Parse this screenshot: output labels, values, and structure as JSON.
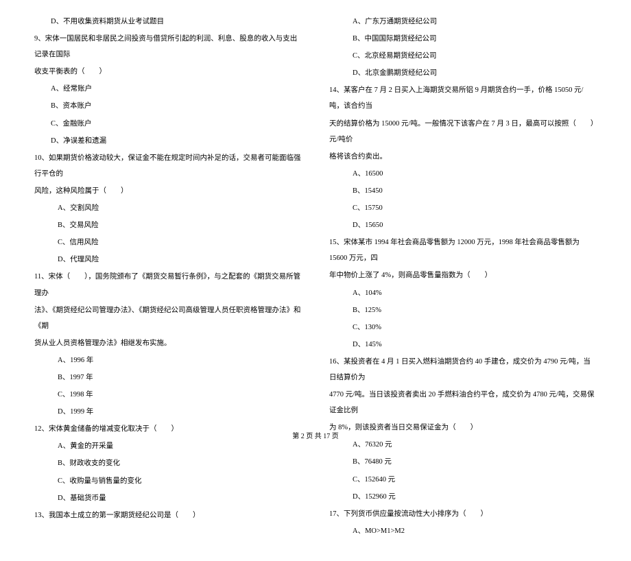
{
  "left": {
    "lines": [
      {
        "cls": "indent1",
        "text": "D、不用收集资料期货从业考试题目"
      },
      {
        "cls": "",
        "text": "9、宋体一国居民和非居民之间投资与借贷所引起的利润、利息、股息的收入与支出记录在国际"
      },
      {
        "cls": "",
        "text": "收支平衡表的（　　）"
      },
      {
        "cls": "indent1",
        "text": "A、经常账户"
      },
      {
        "cls": "indent1",
        "text": "B、资本账户"
      },
      {
        "cls": "indent1",
        "text": "C、金融账户"
      },
      {
        "cls": "indent1",
        "text": "D、净误差和遗漏"
      },
      {
        "cls": "",
        "text": "10、如果期货价格波动较大，保证金不能在规定时间内补足的话，交易者可能面临强行平仓的"
      },
      {
        "cls": "",
        "text": "风险，这种风险属于（　　）"
      },
      {
        "cls": "indent2",
        "text": "A、交割风险"
      },
      {
        "cls": "indent2",
        "text": "B、交易风险"
      },
      {
        "cls": "indent2",
        "text": "C、信用风险"
      },
      {
        "cls": "indent2",
        "text": "D、代理风险"
      },
      {
        "cls": "",
        "text": "11、宋体（　　），国务院颁布了《期货交易暂行条例》，与之配套的《期货交易所管理办"
      },
      {
        "cls": "",
        "text": "法》、《期货经纪公司管理办法》、《期货经纪公司高级管理人员任职资格管理办法》和《期"
      },
      {
        "cls": "",
        "text": "货从业人员资格管理办法》相继发布实施。"
      },
      {
        "cls": "indent2",
        "text": "A、1996 年"
      },
      {
        "cls": "indent2",
        "text": "B、1997 年"
      },
      {
        "cls": "indent2",
        "text": "C、1998 年"
      },
      {
        "cls": "indent2",
        "text": "D、1999 年"
      },
      {
        "cls": "",
        "text": "12、宋体黄金储备的增减变化取决于（　　）"
      },
      {
        "cls": "indent2",
        "text": "A、黄金的开采量"
      },
      {
        "cls": "indent2",
        "text": "B、财政收支的变化"
      },
      {
        "cls": "indent2",
        "text": "C、收购量与销售量的变化"
      },
      {
        "cls": "indent2",
        "text": "D、基础货币量"
      },
      {
        "cls": "",
        "text": "13、我国本土成立的第一家期货经纪公司是（　　）"
      }
    ]
  },
  "right": {
    "lines": [
      {
        "cls": "indent2",
        "text": "A、广东万通期货经纪公司"
      },
      {
        "cls": "indent2",
        "text": "B、中国国际期货经纪公司"
      },
      {
        "cls": "indent2",
        "text": "C、北京经易期货经纪公司"
      },
      {
        "cls": "indent2",
        "text": "D、北京金鹏期货经纪公司"
      },
      {
        "cls": "",
        "text": "14、某客户在 7 月 2 日买入上海期货交易所铝 9 月期货合约一手，价格 15050 元/吨，该合约当"
      },
      {
        "cls": "",
        "text": "天的结算价格为 15000 元/吨。一般情况下该客户在 7 月 3 日，最高可以按照（　　）元/吨价"
      },
      {
        "cls": "",
        "text": "格将该合约卖出。"
      },
      {
        "cls": "indent2",
        "text": "A、16500"
      },
      {
        "cls": "indent2",
        "text": "B、15450"
      },
      {
        "cls": "indent2",
        "text": "C、15750"
      },
      {
        "cls": "indent2",
        "text": "D、15650"
      },
      {
        "cls": "",
        "text": "15、宋体某市 1994 年社会商品零售额为 12000 万元，1998 年社会商品零售额为 15600 万元，四"
      },
      {
        "cls": "",
        "text": "年中物价上涨了 4%，则商品零售量指数为（　　）"
      },
      {
        "cls": "indent2",
        "text": "A、104%"
      },
      {
        "cls": "indent2",
        "text": "B、125%"
      },
      {
        "cls": "indent2",
        "text": "C、130%"
      },
      {
        "cls": "indent2",
        "text": "D、145%"
      },
      {
        "cls": "",
        "text": "16、某投资者在 4 月 1 日买入燃料油期货合约 40 手建仓，成交价为 4790 元/吨，当日结算价为"
      },
      {
        "cls": "",
        "text": "4770 元/吨。当日该投资者卖出 20 手燃料油合约平仓，成交价为 4780 元/吨，交易保证金比例"
      },
      {
        "cls": "",
        "text": "为 8%，则该投资者当日交易保证金为（　　）"
      },
      {
        "cls": "indent2",
        "text": "A、76320 元"
      },
      {
        "cls": "indent2",
        "text": "B、76480 元"
      },
      {
        "cls": "indent2",
        "text": "C、152640 元"
      },
      {
        "cls": "indent2",
        "text": "D、152960 元"
      },
      {
        "cls": "",
        "text": "17、下列货币供应量按流动性大小排序为（　　）"
      },
      {
        "cls": "indent2",
        "text": "A、MO>M1>M2"
      }
    ]
  },
  "footer": "第 2 页 共 17 页"
}
